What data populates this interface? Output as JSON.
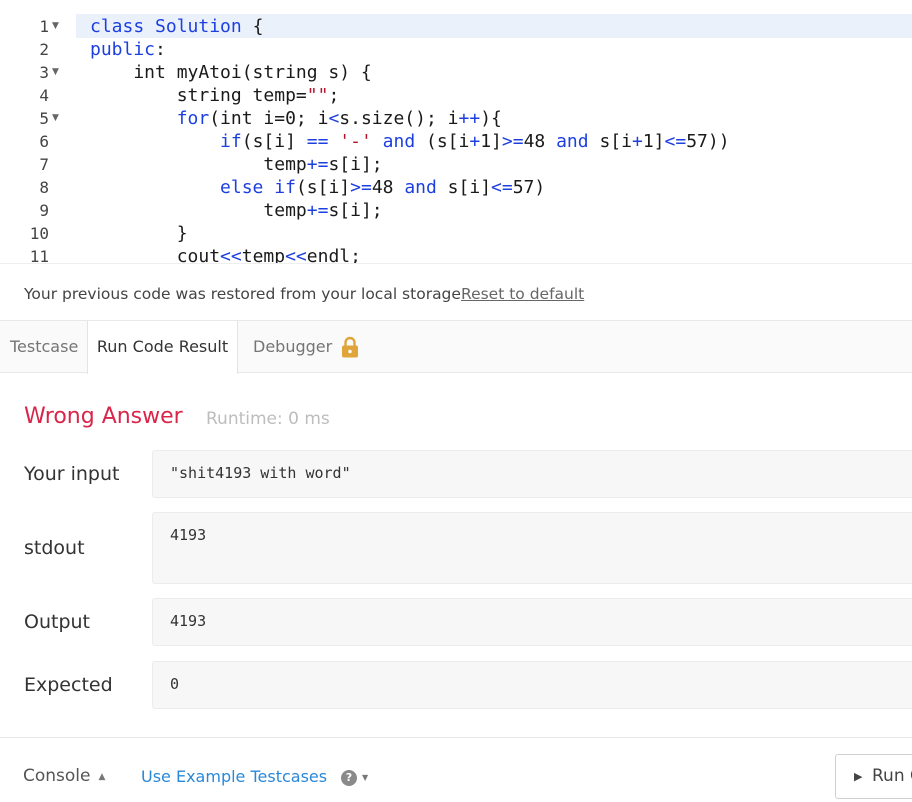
{
  "editor": {
    "lines": [
      {
        "num": "1",
        "fold": true,
        "html": "<span class=\"kw\">class</span> <span class=\"kw\">Solution</span> {"
      },
      {
        "num": "2",
        "fold": false,
        "html": "<span class=\"kw\">public</span>:"
      },
      {
        "num": "3",
        "fold": true,
        "html": "    int myAtoi(string s) {"
      },
      {
        "num": "4",
        "fold": false,
        "html": "        string temp=<span class=\"str\">\"\"</span>;"
      },
      {
        "num": "5",
        "fold": true,
        "html": "        <span class=\"kw\">for</span>(int i=0; i<span class=\"op\">&lt;</span>s.size(); i<span class=\"op\">++</span>){"
      },
      {
        "num": "6",
        "fold": false,
        "html": "            <span class=\"kw\">if</span>(s[i] <span class=\"op\">==</span> <span class=\"str\">'-'</span> <span class=\"kw\">and</span> (s[i<span class=\"op\">+</span>1]<span class=\"op\">&gt;=</span>48 <span class=\"kw\">and</span> s[i<span class=\"op\">+</span>1]<span class=\"op\">&lt;=</span>57))"
      },
      {
        "num": "7",
        "fold": false,
        "html": "                temp<span class=\"op\">+=</span>s[i];"
      },
      {
        "num": "8",
        "fold": false,
        "html": "            <span class=\"kw\">else</span> <span class=\"kw\">if</span>(s[i]<span class=\"op\">&gt;=</span>48 <span class=\"kw\">and</span> s[i]<span class=\"op\">&lt;=</span>57)"
      },
      {
        "num": "9",
        "fold": false,
        "html": "                temp<span class=\"op\">+=</span>s[i];"
      },
      {
        "num": "10",
        "fold": false,
        "html": "        }"
      },
      {
        "num": "11",
        "fold": false,
        "html": "        cout<span class=\"op\">&lt;&lt;</span>temp<span class=\"op\">&lt;&lt;</span>endl;"
      }
    ]
  },
  "restore": {
    "message": "Your previous code was restored from your local storage.",
    "reset_label": "Reset to default"
  },
  "tabs": {
    "testcase": "Testcase",
    "run_code_result": "Run Code Result",
    "debugger": "Debugger"
  },
  "result": {
    "verdict": "Wrong Answer",
    "runtime": "Runtime: 0 ms",
    "rows": {
      "input": {
        "label": "Your input",
        "value": "\"shit4193 with word\""
      },
      "stdout": {
        "label": "stdout",
        "value": "4193"
      },
      "output": {
        "label": "Output",
        "value": "4193"
      },
      "expected": {
        "label": "Expected",
        "value": "0"
      }
    }
  },
  "footer": {
    "console_label": "Console",
    "example_label": "Use Example Testcases",
    "help_glyph": "?",
    "run_label": "Run C"
  },
  "colors": {
    "keyword": "#1d3fe0",
    "string": "#b5152f",
    "wrong_answer": "#d9254a",
    "link": "#2a88d8",
    "lock": "#e0a53a"
  }
}
